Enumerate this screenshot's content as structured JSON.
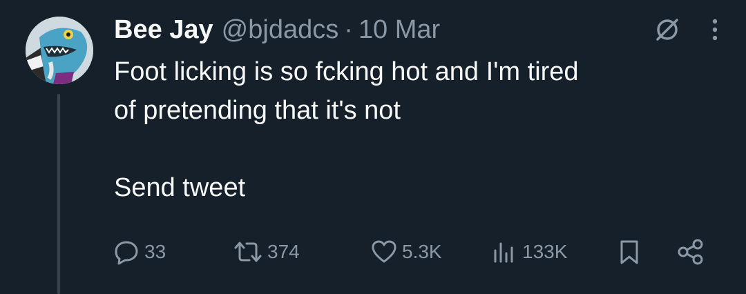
{
  "tweet": {
    "author_name": "Bee Jay",
    "author_handle": "@bjdadcs",
    "separator": "·",
    "date": "10 Mar",
    "text_lines": [
      "Foot licking is so fcking hot and I'm tired",
      "of pretending that it's not",
      "Send tweet"
    ]
  },
  "top_icons": [
    "no-ads-icon",
    "more-options-icon"
  ],
  "actions": {
    "replies": {
      "icon": "reply-icon",
      "count": "33"
    },
    "retweets": {
      "icon": "retweet-icon",
      "count": "374"
    },
    "likes": {
      "icon": "heart-icon",
      "count": "5.3K"
    },
    "views": {
      "icon": "views-icon",
      "count": "133K"
    },
    "bookmark": {
      "icon": "bookmark-icon"
    },
    "share": {
      "icon": "share-icon"
    }
  },
  "colors": {
    "background": "#15202b",
    "primary_text": "#f7f9f9",
    "secondary_text": "#8b98a5",
    "thread_line": "#38444d"
  }
}
